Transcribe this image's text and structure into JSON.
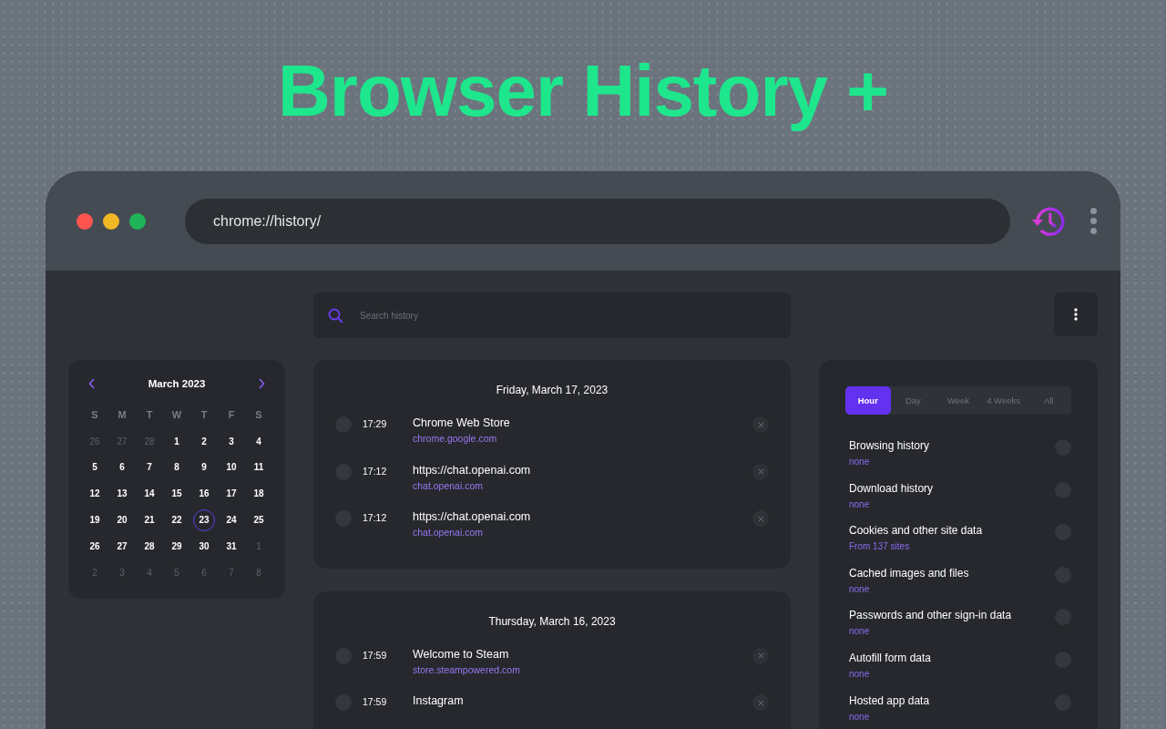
{
  "headline": "Browser History +",
  "browser": {
    "address": "chrome://history/"
  },
  "search": {
    "placeholder": "Search history"
  },
  "calendar": {
    "month": "March 2023",
    "weekdays": [
      "S",
      "M",
      "T",
      "W",
      "T",
      "F",
      "S"
    ],
    "days": [
      {
        "label": "26",
        "muted": true,
        "selected": false
      },
      {
        "label": "27",
        "muted": true,
        "selected": false
      },
      {
        "label": "28",
        "muted": true,
        "selected": false
      },
      {
        "label": "1",
        "muted": false,
        "selected": false
      },
      {
        "label": "2",
        "muted": false,
        "selected": false
      },
      {
        "label": "3",
        "muted": false,
        "selected": false
      },
      {
        "label": "4",
        "muted": false,
        "selected": false
      },
      {
        "label": "5",
        "muted": false,
        "selected": false
      },
      {
        "label": "6",
        "muted": false,
        "selected": false
      },
      {
        "label": "7",
        "muted": false,
        "selected": false
      },
      {
        "label": "8",
        "muted": false,
        "selected": false
      },
      {
        "label": "9",
        "muted": false,
        "selected": false
      },
      {
        "label": "10",
        "muted": false,
        "selected": false
      },
      {
        "label": "11",
        "muted": false,
        "selected": false
      },
      {
        "label": "12",
        "muted": false,
        "selected": false
      },
      {
        "label": "13",
        "muted": false,
        "selected": false
      },
      {
        "label": "14",
        "muted": false,
        "selected": false
      },
      {
        "label": "15",
        "muted": false,
        "selected": false
      },
      {
        "label": "16",
        "muted": false,
        "selected": false
      },
      {
        "label": "17",
        "muted": false,
        "selected": false
      },
      {
        "label": "18",
        "muted": false,
        "selected": false
      },
      {
        "label": "19",
        "muted": false,
        "selected": false
      },
      {
        "label": "20",
        "muted": false,
        "selected": false
      },
      {
        "label": "21",
        "muted": false,
        "selected": false
      },
      {
        "label": "22",
        "muted": false,
        "selected": false
      },
      {
        "label": "23",
        "muted": false,
        "selected": true
      },
      {
        "label": "24",
        "muted": false,
        "selected": false
      },
      {
        "label": "25",
        "muted": false,
        "selected": false
      },
      {
        "label": "26",
        "muted": false,
        "selected": false
      },
      {
        "label": "27",
        "muted": false,
        "selected": false
      },
      {
        "label": "28",
        "muted": false,
        "selected": false
      },
      {
        "label": "29",
        "muted": false,
        "selected": false
      },
      {
        "label": "30",
        "muted": false,
        "selected": false
      },
      {
        "label": "31",
        "muted": false,
        "selected": false
      },
      {
        "label": "1",
        "muted": true,
        "selected": false
      },
      {
        "label": "2",
        "muted": true,
        "selected": false
      },
      {
        "label": "3",
        "muted": true,
        "selected": false
      },
      {
        "label": "4",
        "muted": true,
        "selected": false
      },
      {
        "label": "5",
        "muted": true,
        "selected": false
      },
      {
        "label": "6",
        "muted": true,
        "selected": false
      },
      {
        "label": "7",
        "muted": true,
        "selected": false
      },
      {
        "label": "8",
        "muted": true,
        "selected": false
      }
    ]
  },
  "history": [
    {
      "date": "Friday, March 17, 2023",
      "entries": [
        {
          "time": "17:29",
          "title": "Chrome Web Store",
          "url": "chrome.google.com",
          "checked": false
        },
        {
          "time": "17:12",
          "title": "https://chat.openai.com",
          "url": "chat.openai.com",
          "checked": false
        },
        {
          "time": "17:12",
          "title": "https://chat.openai.com",
          "url": "chat.openai.com",
          "checked": false
        }
      ]
    },
    {
      "date": "Thursday, March 16, 2023",
      "entries": [
        {
          "time": "17:59",
          "title": "Welcome to Steam",
          "url": "store.steampowered.com",
          "checked": false
        },
        {
          "time": "17:59",
          "title": "Instagram",
          "checked": false
        }
      ]
    }
  ],
  "clear_panel": {
    "ranges": [
      {
        "label": "Hour",
        "selected": true
      },
      {
        "label": "Day",
        "selected": false
      },
      {
        "label": "Week",
        "selected": false
      },
      {
        "label": "4 Weeks",
        "selected": false
      },
      {
        "label": "All",
        "selected": false
      }
    ],
    "items": [
      {
        "label": "Browsing history",
        "detail": "none",
        "checked": false
      },
      {
        "label": "Download history",
        "detail": "none",
        "checked": false
      },
      {
        "label": "Cookies and other site data",
        "detail": "From 137 sites",
        "checked": false
      },
      {
        "label": "Cached images and files",
        "detail": "none",
        "checked": false
      },
      {
        "label": "Passwords and other sign-in data",
        "detail": "none",
        "checked": false
      },
      {
        "label": "Autofill form data",
        "detail": "none",
        "checked": false
      },
      {
        "label": "Hosted app data",
        "detail": "none",
        "checked": false
      }
    ]
  }
}
